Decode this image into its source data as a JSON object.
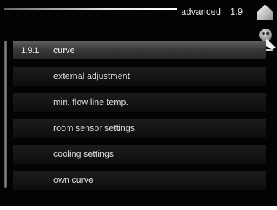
{
  "header": {
    "title": "advanced",
    "menu_number": "1.9",
    "home_icon": "home-icon",
    "menu_icon": "settings-wrench-icon"
  },
  "menu": {
    "items": [
      {
        "number": "1.9.1",
        "label": "curve",
        "selected": true
      },
      {
        "number": "",
        "label": "external adjustment",
        "selected": false
      },
      {
        "number": "",
        "label": "min. flow line temp.",
        "selected": false
      },
      {
        "number": "",
        "label": "room sensor settings",
        "selected": false
      },
      {
        "number": "",
        "label": "cooling settings",
        "selected": false
      },
      {
        "number": "",
        "label": "own curve",
        "selected": false
      }
    ]
  },
  "colors": {
    "background": "#030303",
    "text": "#d6d6d6",
    "selected_row": "#4a4a4a"
  }
}
